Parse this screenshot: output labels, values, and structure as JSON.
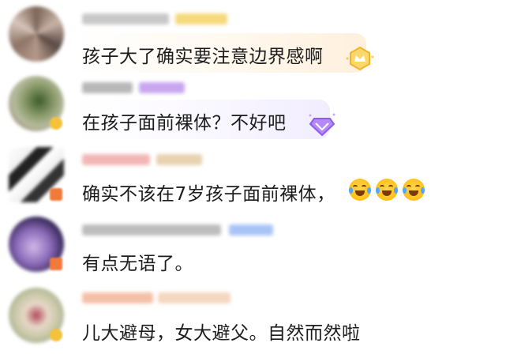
{
  "comments": [
    {
      "text": "孩子大了确实要注意边界感啊"
    },
    {
      "text": "在孩子面前裸体？不好吧"
    },
    {
      "text": "确实不该在7岁孩子面前裸体，"
    },
    {
      "text": "有点无语了。"
    },
    {
      "text": "儿大避母，女大避父。自然而然啦"
    }
  ],
  "badges": {
    "comment_1": "gold-crown-badge-icon",
    "comment_2": "purple-diamond-badge-icon"
  },
  "emojis": [
    "tears-of-joy-icon",
    "tears-of-joy-icon",
    "tears-of-joy-icon"
  ],
  "colors": {
    "text": "#1c1c1c",
    "gold_bubble": "#fff0dd",
    "purple_bubble": "#f1edff"
  }
}
